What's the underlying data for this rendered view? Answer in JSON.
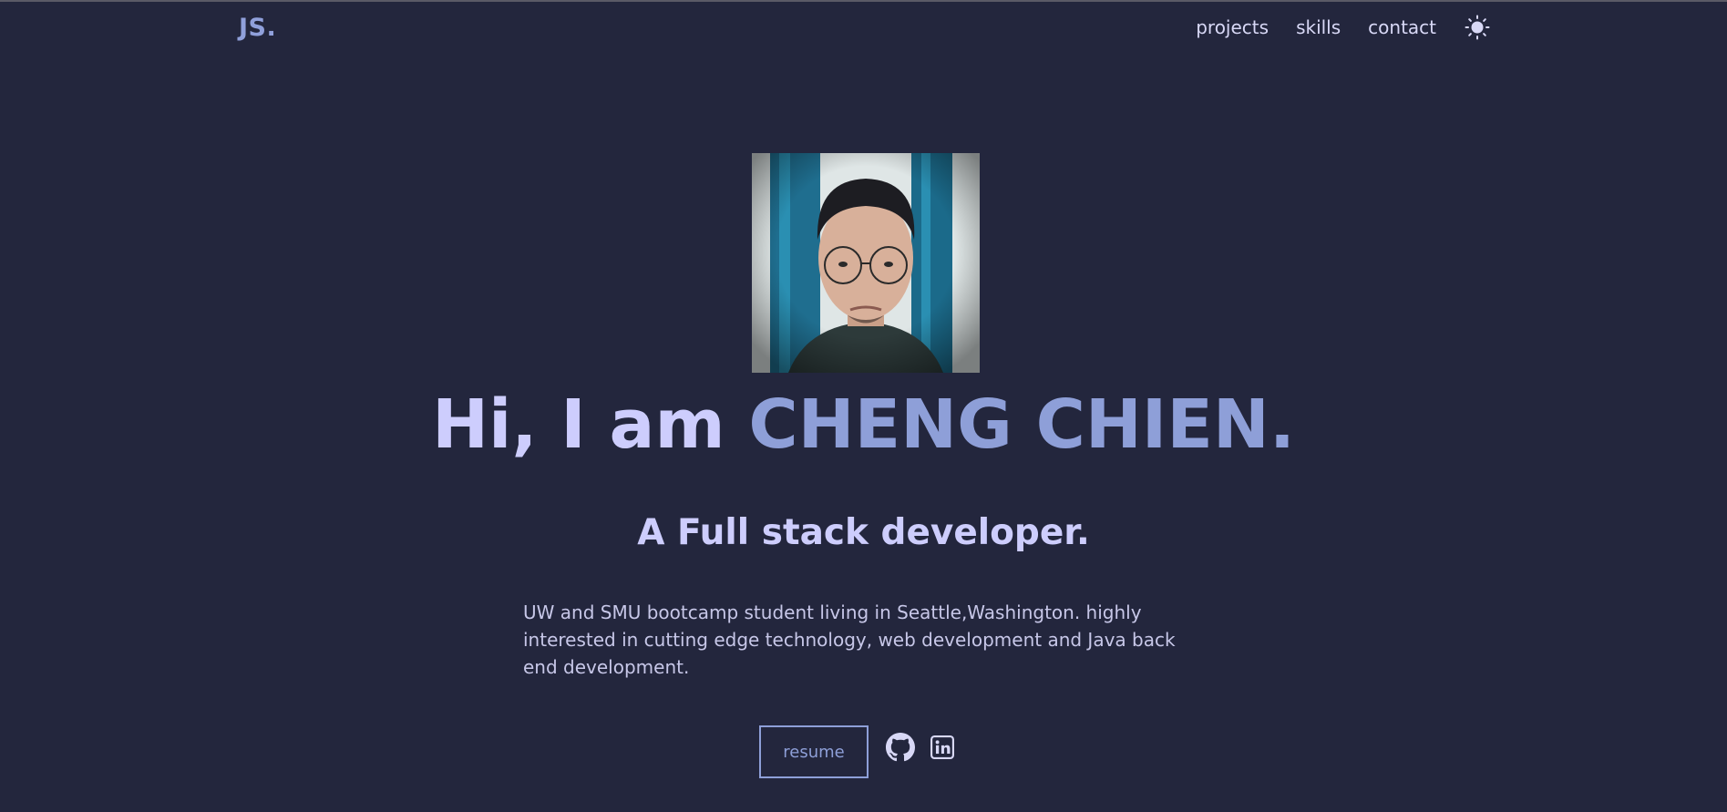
{
  "header": {
    "logo": "JS.",
    "nav": [
      "projects",
      "skills",
      "contact"
    ],
    "theme_toggle_icon": "sun-icon"
  },
  "hero": {
    "photo_icon": "profile-photo",
    "greeting": "Hi, I am",
    "name": "CHENG CHIEN.",
    "role": "A Full stack developer.",
    "bio": "UW and SMU bootcamp student living in Seattle,Washington. highly interested in cutting edge technology, web development and Java back end development.",
    "resume_label": "resume",
    "social_icons": [
      "github-icon",
      "linkedin-icon"
    ]
  },
  "colors": {
    "background": "#23263d",
    "accent": "#8e9fd8",
    "heading": "#cdcdfd",
    "text": "#c7c7e8"
  }
}
